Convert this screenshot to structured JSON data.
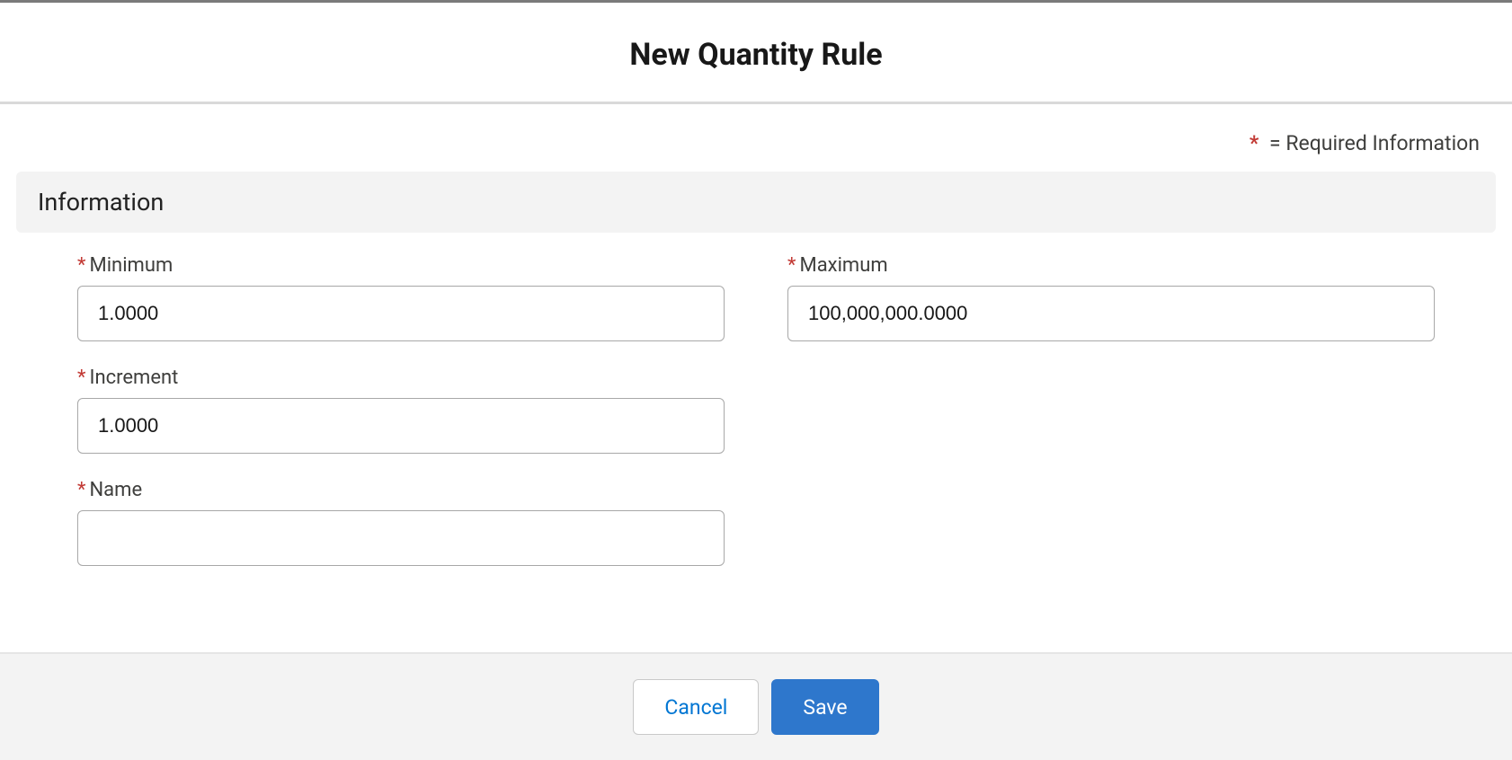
{
  "modal": {
    "title": "New Quantity Rule"
  },
  "requiredNote": {
    "asterisk": "*",
    "text": "= Required Information"
  },
  "section": {
    "title": "Information"
  },
  "fields": {
    "minimum": {
      "label": "Minimum",
      "value": "1.0000"
    },
    "maximum": {
      "label": "Maximum",
      "value": "100,000,000.0000"
    },
    "increment": {
      "label": "Increment",
      "value": "1.0000"
    },
    "name": {
      "label": "Name",
      "value": ""
    }
  },
  "buttons": {
    "cancel": "Cancel",
    "save": "Save"
  },
  "asterisk": "*"
}
